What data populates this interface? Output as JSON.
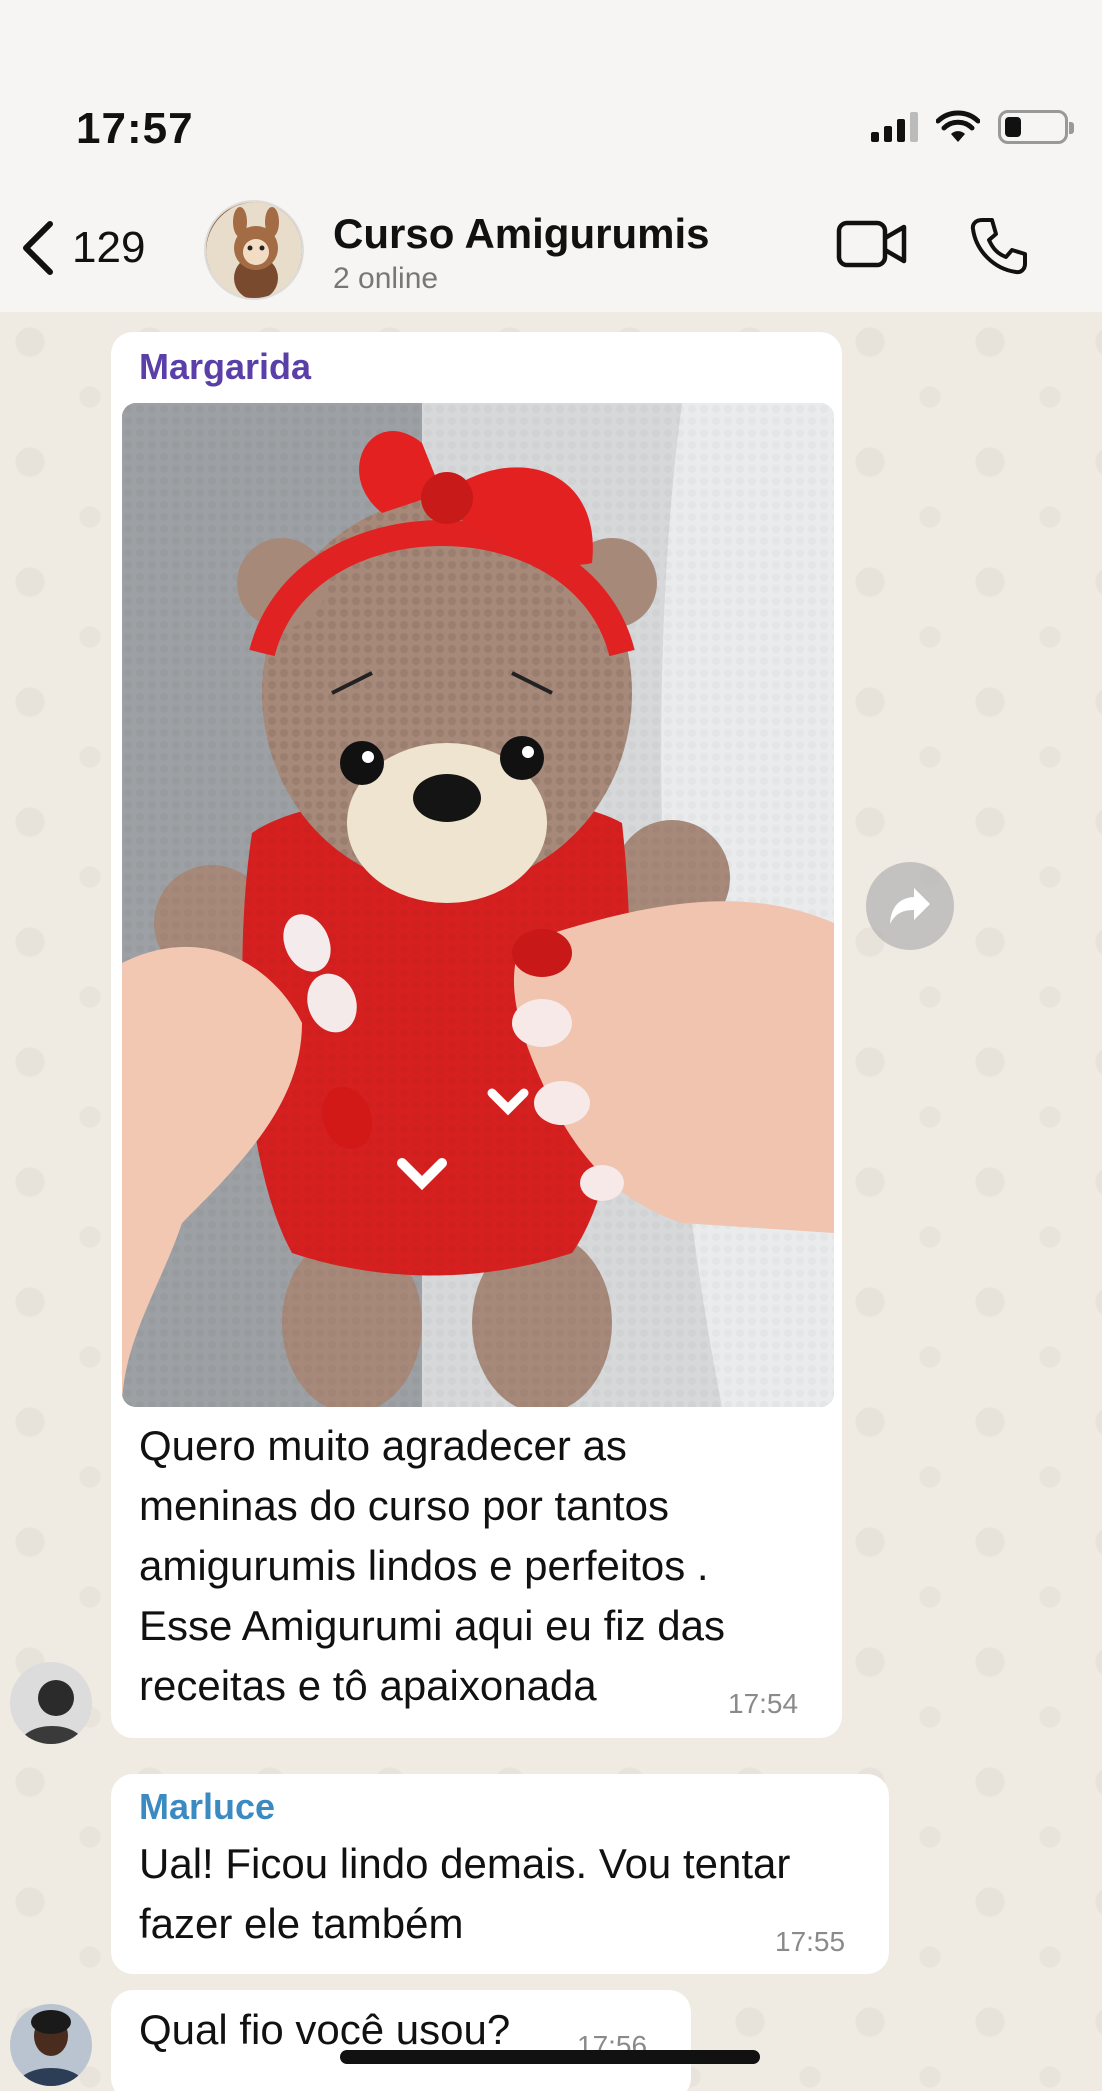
{
  "status_bar": {
    "time": "17:57",
    "battery_level": 0.28
  },
  "header": {
    "back_count": "129",
    "title": "Curso Amigurumis",
    "subtitle": "2 online"
  },
  "messages": [
    {
      "sender": "Margarida",
      "sender_color": "#5b3fa8",
      "has_photo": true,
      "text_lines": [
        "Quero muito agradecer as",
        "meninas do curso por tantos",
        "amigurumis lindos e perfeitos .",
        "Esse Amigurumi aqui eu fiz das",
        "receitas e tô apaixonada"
      ],
      "time": "17:54"
    },
    {
      "sender": "Marluce",
      "sender_color": "#3b8bc2",
      "text_lines": [
        "Ual! Ficou lindo demais. Vou tentar",
        "fazer ele também"
      ],
      "time": "17:55"
    },
    {
      "sender": "",
      "text_lines": [
        "Qual fio você usou?"
      ],
      "time": "17:56"
    }
  ],
  "icons": {
    "back": "chevron-left-icon",
    "video": "video-camera-icon",
    "call": "phone-icon",
    "forward": "forward-arrow-icon"
  },
  "colors": {
    "background": "#efeae2",
    "bubble": "#ffffff",
    "header": "#f6f5f3"
  }
}
